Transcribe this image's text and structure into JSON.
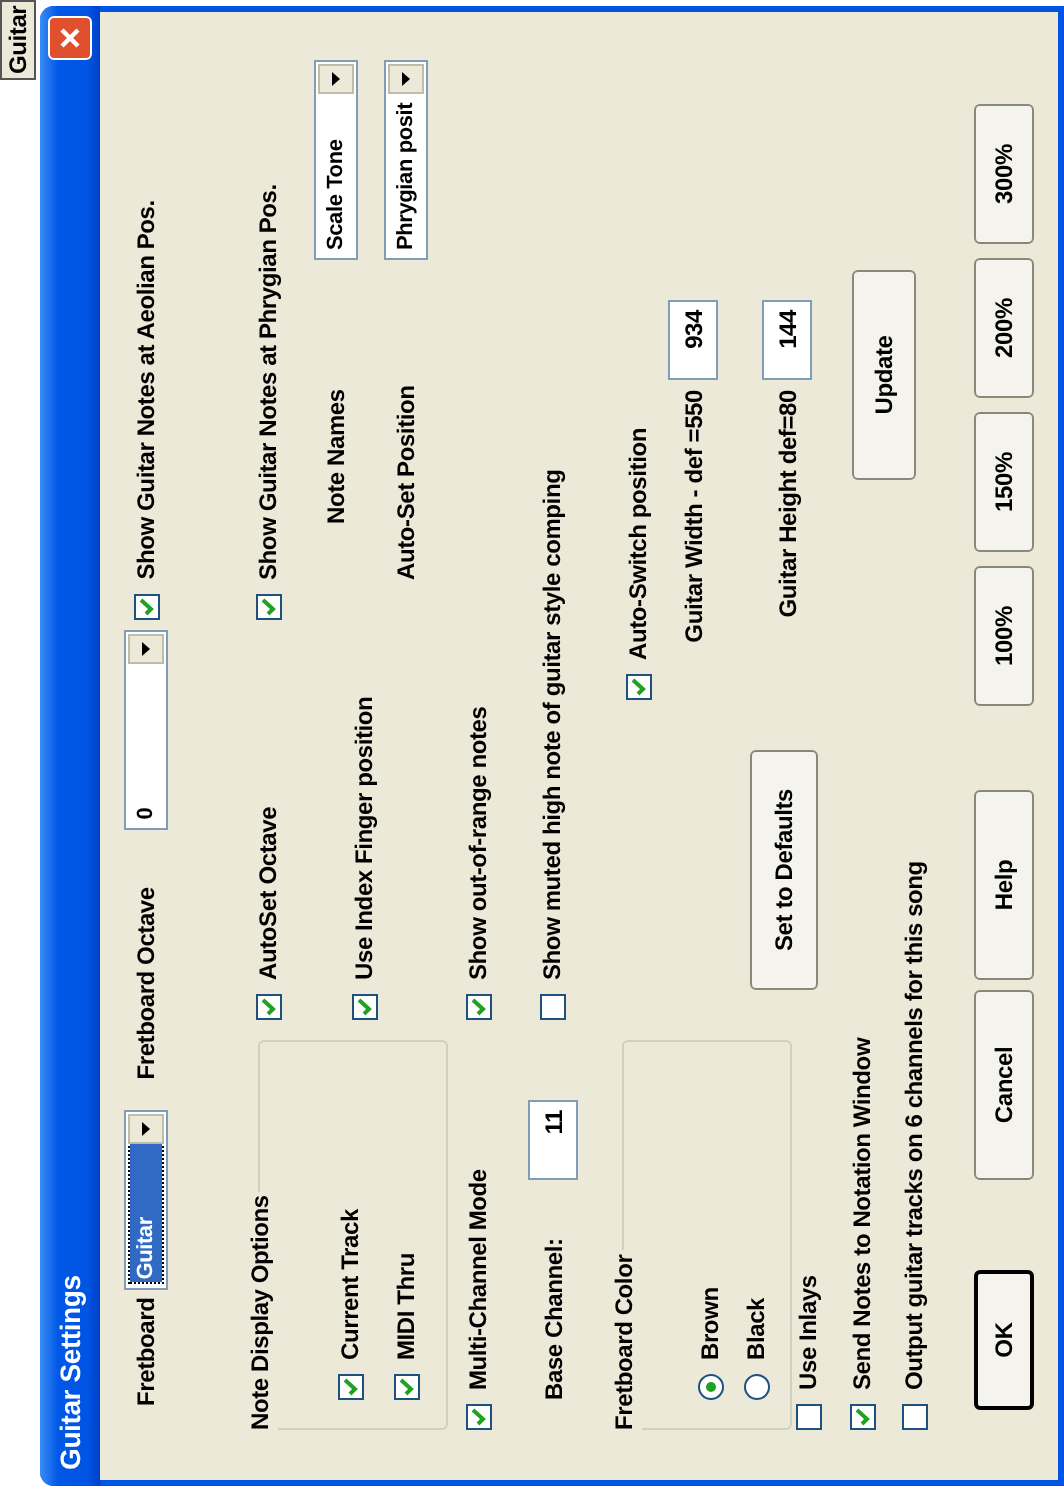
{
  "background_button": {
    "label": "Guitar"
  },
  "window": {
    "title": "Guitar Settings"
  },
  "fretboard": {
    "label": "Fretboard",
    "value": "Guitar",
    "highlighted": true
  },
  "fretboard_octave": {
    "label": "Fretboard Octave",
    "value": "0",
    "highlighted": false
  },
  "show_aeolian": {
    "label": "Show Guitar Notes at Aeolian Pos.",
    "checked": true
  },
  "note_display_options": {
    "title": "Note Display Options",
    "options": [
      {
        "label": "Current Track",
        "checked": true
      },
      {
        "label": "MIDI Thru",
        "checked": true
      }
    ]
  },
  "multi_channel_mode": {
    "label": "Multi-Channel Mode",
    "checked": true
  },
  "base_channel": {
    "label": "Base Channel:",
    "value": "11"
  },
  "fretboard_color": {
    "title": "Fretboard Color",
    "options": [
      {
        "label": "Brown",
        "selected": true
      },
      {
        "label": "Black",
        "selected": false
      }
    ]
  },
  "use_inlays": {
    "label": "Use Inlays",
    "checked": false
  },
  "send_notes": {
    "label": "Send Notes to Notation Window",
    "checked": true
  },
  "output_tracks": {
    "label": "Output guitar tracks on 6 channels for this song",
    "checked": false
  },
  "middle_options": [
    {
      "label": "AutoSet Octave",
      "checked": true
    },
    {
      "label": "Use Index Finger position",
      "checked": true
    },
    {
      "label": "Show out-of-range notes",
      "checked": true
    },
    {
      "label": "Show muted high note of guitar style comping",
      "checked": false
    }
  ],
  "set_defaults": {
    "label": "Set to Defaults"
  },
  "show_phrygian": {
    "label": "Show Guitar Notes at Phrygian Pos.",
    "checked": true
  },
  "note_names": {
    "label": "Note Names",
    "value": "Scale Tone",
    "highlighted": false
  },
  "auto_set_position": {
    "label": "Auto-Set Position",
    "value": "Phrygian posit",
    "highlighted": false
  },
  "auto_switch": {
    "label": "Auto-Switch position",
    "checked": true
  },
  "guitar_width": {
    "label": "Guitar Width - def =550",
    "value": "934"
  },
  "guitar_height": {
    "label": "Guitar Height def=80",
    "value": "144"
  },
  "update": {
    "label": "Update"
  },
  "buttons": [
    {
      "label": "OK",
      "default": true
    },
    {
      "label": "Cancel",
      "default": false
    },
    {
      "label": "Help",
      "default": false
    }
  ],
  "zoom_buttons": [
    {
      "label": "100%"
    },
    {
      "label": "150%"
    },
    {
      "label": "200%"
    },
    {
      "label": "300%"
    }
  ]
}
